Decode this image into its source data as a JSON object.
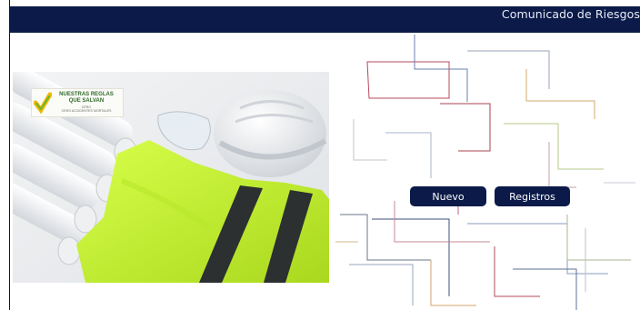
{
  "header": {
    "title": "Comunicado de Riesgos"
  },
  "hero_image": {
    "logo": {
      "line1": "NUESTRAS REGLAS",
      "line2": "QUE SALVAN",
      "line3": "CERO",
      "line4": "CERO ACCIDENTES MORTALES"
    }
  },
  "actions": {
    "nuevo_label": "Nuevo",
    "registros_label": "Registros"
  },
  "colors": {
    "header_bg": "#0b1a48",
    "button_bg": "#0b1a48",
    "vest": "#c9f23a"
  }
}
